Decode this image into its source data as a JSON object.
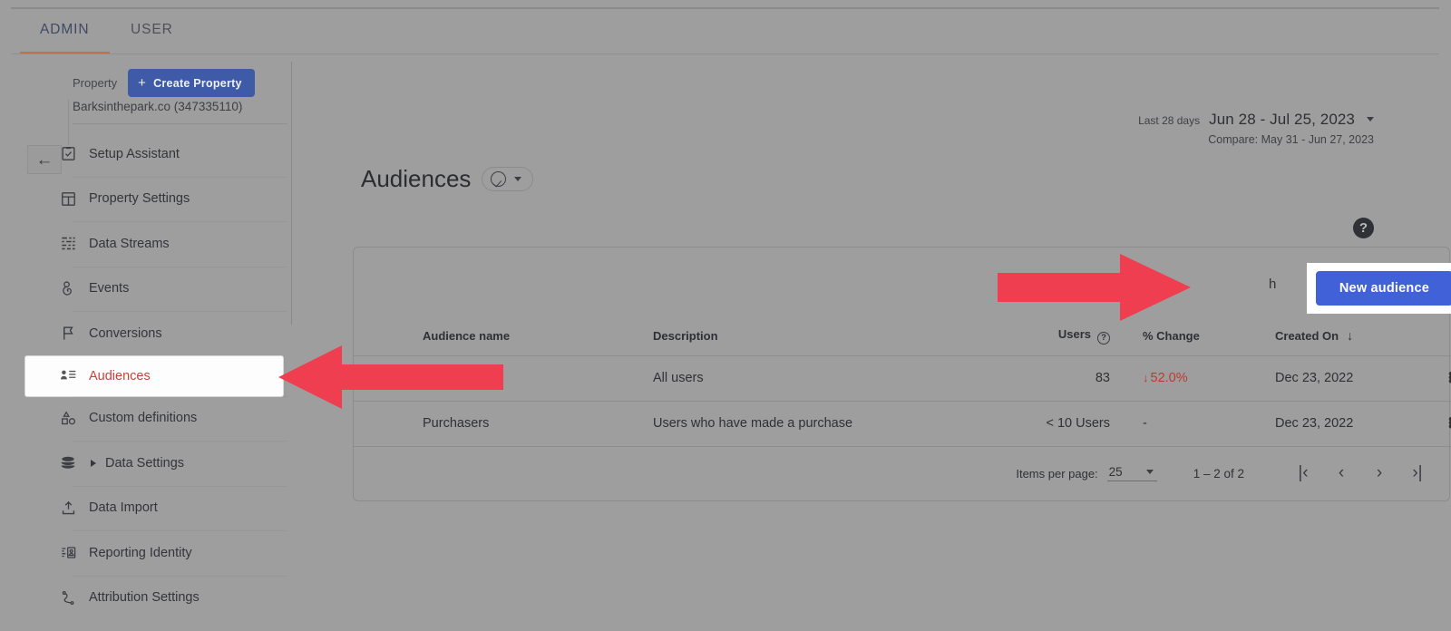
{
  "tabs": [
    {
      "label": "ADMIN",
      "active": true
    },
    {
      "label": "USER",
      "active": false
    }
  ],
  "sidebar": {
    "back_icon": "arrow-left-icon",
    "property_label": "Property",
    "create_property_label": "Create Property",
    "create_property_plus": "+",
    "property_name": "Barksinthepark.co (347335110)",
    "items": [
      {
        "label": "Setup Assistant",
        "icon": "clipboard-check-icon"
      },
      {
        "label": "Property Settings",
        "icon": "layout-panels-icon"
      },
      {
        "label": "Data Streams",
        "icon": "data-streams-icon"
      },
      {
        "label": "Events",
        "icon": "tap-hand-icon"
      },
      {
        "label": "Conversions",
        "icon": "flag-icon"
      },
      {
        "label": "Audiences",
        "icon": "audience-people-icon",
        "selected": true
      },
      {
        "label": "Custom definitions",
        "icon": "shapes-icon"
      },
      {
        "label": "Data Settings",
        "icon": "database-icon",
        "expandable": true
      },
      {
        "label": "Data Import",
        "icon": "upload-icon"
      },
      {
        "label": "Reporting Identity",
        "icon": "id-card-icon"
      },
      {
        "label": "Attribution Settings",
        "icon": "path-curve-icon"
      }
    ]
  },
  "header": {
    "date_preset": "Last 28 days",
    "date_range": "Jun 28 - Jul 25, 2023",
    "compare": "Compare: May 31 - Jun 27, 2023",
    "page_title": "Audiences",
    "help_icon_glyph": "?"
  },
  "card": {
    "search_ghost": "h",
    "new_audience_label": "New audience",
    "columns": [
      {
        "key": "name",
        "label": "Audience name"
      },
      {
        "key": "desc",
        "label": "Description"
      },
      {
        "key": "users",
        "label": "Users",
        "help": "?"
      },
      {
        "key": "chg",
        "label": "% Change"
      },
      {
        "key": "date",
        "label": "Created On",
        "sort": "↓"
      },
      {
        "key": "menu",
        "label": ""
      }
    ],
    "rows": [
      {
        "name": "",
        "desc": "All users",
        "users": "83",
        "change": "52.0%",
        "change_direction": "down",
        "change_arrow": "↓",
        "created_on": "Dec 23, 2022"
      },
      {
        "name": "Purchasers",
        "desc": "Users who have made a purchase",
        "users": "< 10 Users",
        "change": "-",
        "change_direction": "none",
        "change_arrow": "",
        "created_on": "Dec 23, 2022"
      }
    ],
    "footer": {
      "items_per_page_label": "Items per page:",
      "items_per_page_value": "25",
      "range_label": "1 – 2 of 2",
      "first_page": "|‹",
      "prev_page": "‹",
      "next_page": "›",
      "last_page": "›|"
    }
  },
  "annotations": {
    "arrow_color": "#ef3e4f",
    "arrow_right_name": "arrow-pointing-new-audience",
    "arrow_left_name": "arrow-pointing-audiences-nav"
  },
  "colors": {
    "accent_blue": "#4061d8",
    "tab_underline": "#c1714a",
    "selected_nav_text": "#c8413c",
    "negative_change": "#c0392b",
    "overlay_gray": "#9e9e9e"
  }
}
